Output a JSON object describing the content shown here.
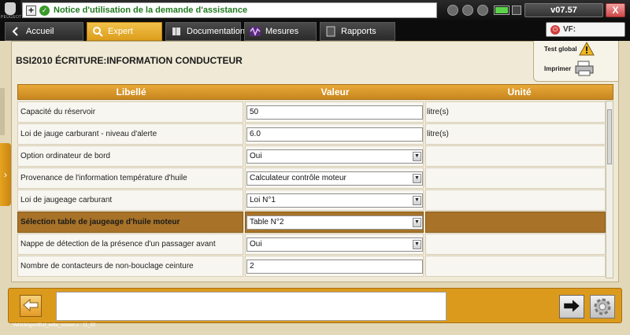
{
  "titlebar": {
    "brand": "PEUGEOT",
    "notice": "Notice d'utilisation de la demande d'assistance",
    "version": "v07.57",
    "close_label": "X"
  },
  "tabs": [
    {
      "label": "Accueil",
      "icon": "back-arrow-icon"
    },
    {
      "label": "Expert",
      "icon": "magnifier-icon",
      "active": true
    },
    {
      "label": "Documentation",
      "icon": "book-icon"
    },
    {
      "label": "Mesures",
      "icon": "waveform-icon"
    },
    {
      "label": "Rapports",
      "icon": "folder-icon"
    }
  ],
  "vf": {
    "label": "VF:"
  },
  "page": {
    "title": "BSI2010  ÉCRITURE:INFORMATION CONDUCTEUR",
    "test_global": "Test global",
    "imprimer": "Imprimer"
  },
  "table": {
    "headers": {
      "label": "Libellé",
      "value": "Valeur",
      "unit": "Unité"
    },
    "rows": [
      {
        "label": "Capacité du réservoir",
        "value": "50",
        "unit": "litre(s)",
        "type": "input"
      },
      {
        "label": "Loi de jauge carburant - niveau d'alerte",
        "value": "6.0",
        "unit": "litre(s)",
        "type": "input"
      },
      {
        "label": "Option ordinateur de bord",
        "value": "Oui",
        "unit": "",
        "type": "select"
      },
      {
        "label": "Provenance de l'information température d'huile",
        "value": "Calculateur contrôle moteur",
        "unit": "",
        "type": "select"
      },
      {
        "label": "Loi de jaugeage carburant",
        "value": "Loi N°1",
        "unit": "",
        "type": "select"
      },
      {
        "label": "Sélection table de jaugeage d'huile moteur",
        "value": "Table N°2",
        "unit": "",
        "type": "select",
        "highlight": true
      },
      {
        "label": "Nappe de détection de la présence d'un passager avant",
        "value": "Oui",
        "unit": "",
        "type": "select"
      },
      {
        "label": "Nombre de contacteurs de non-bouclage ceinture",
        "value": "2",
        "unit": "",
        "type": "input"
      }
    ]
  },
  "bottom": {
    "message": "",
    "footer": "Vehicle\\gen\\lfcd_write_screen.s : 11_02"
  },
  "colors": {
    "accent": "#dc9a1c",
    "header": "#c8861e",
    "highlight_row": "#a87328",
    "notice_text": "#1f7a1f"
  }
}
